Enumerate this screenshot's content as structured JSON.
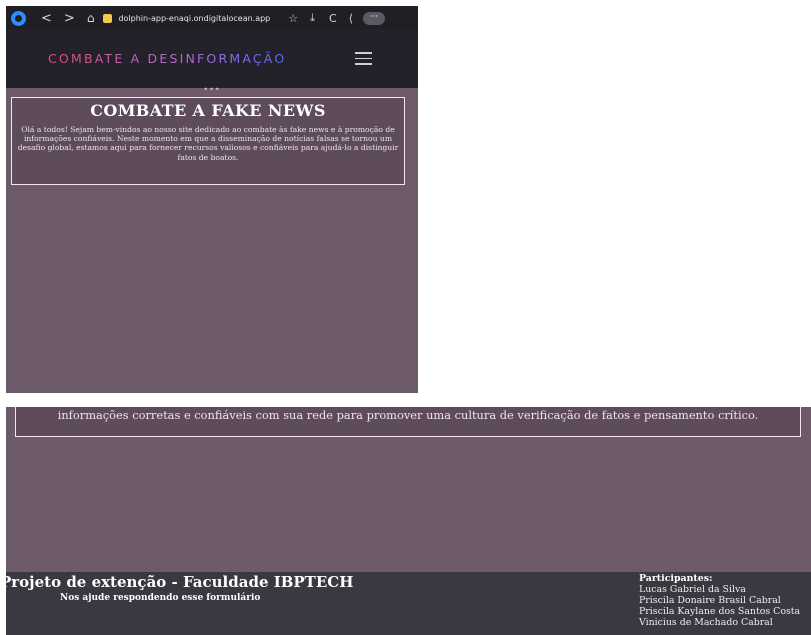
{
  "browser": {
    "url": "dolphin-app-enaqi.ondigitalocean.app",
    "back_icon": "<",
    "forward_icon": ">",
    "home_icon": "⌂",
    "star_icon": "☆",
    "download_icon": "⤓",
    "reload_icon": "C",
    "share_icon": "⟨",
    "more_icon": "···"
  },
  "site": {
    "logo": "COMBATE A DESINFORMAÇÃO",
    "dots": "•••"
  },
  "hero": {
    "title": "COMBATE A FAKE NEWS",
    "text": "Olá a todos! Sejam bem-vindos ao nosso site dedicado ao combate às fake news e à promoção de informações confiáveis. Neste momento em que a disseminação de notícias falsas se tornou um desafio global, estamos aqui para fornecer recursos valiosos e confiáveis para ajudá-lo a distinguir fatos de boatos."
  },
  "second_panel": {
    "partial_text": "informações corretas e confiáveis com sua rede para promover uma cultura de verificação de fatos e pensamento crítico."
  },
  "footer": {
    "project": "Projeto de extenção - Faculdade IBPTECH",
    "form_link": "Nos ajude respondendo esse formulário",
    "participants_title": "Participantes:",
    "participants": [
      "Lucas Gabriel da Silva",
      "Priscila Donaire Brasil Cabral",
      "Priscila Kaylane dos Santos Costa",
      "Vinicius de Machado Cabral"
    ]
  },
  "colors": {
    "page_bg": "#6d5a6a",
    "header_bg": "#23222a",
    "footer_bg": "#3a3840",
    "logo_gradient": [
      "#e14b76",
      "#b56bd7",
      "#5a6cf2"
    ]
  }
}
